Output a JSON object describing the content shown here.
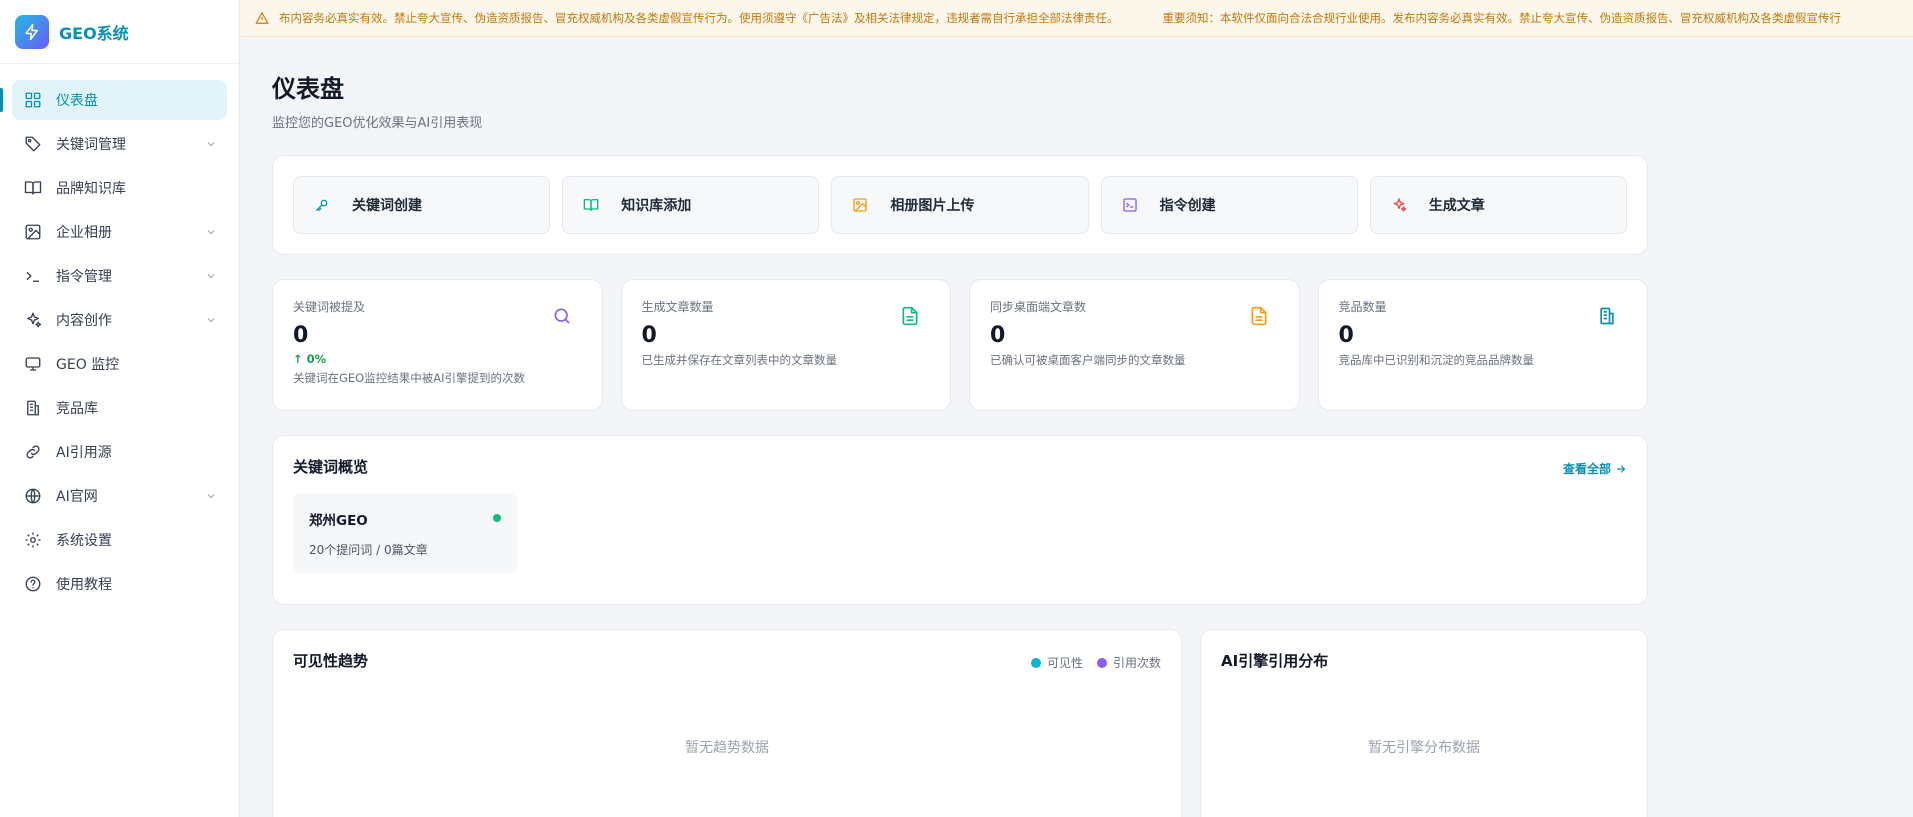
{
  "brand": {
    "name": "GEO系统",
    "logo_icon": "lightning-icon"
  },
  "sidebar": {
    "items": [
      {
        "label": "仪表盘",
        "icon": "dashboard-icon",
        "active": true,
        "expandable": false
      },
      {
        "label": "关键词管理",
        "icon": "tag-icon",
        "active": false,
        "expandable": true
      },
      {
        "label": "品牌知识库",
        "icon": "book-icon",
        "active": false,
        "expandable": false
      },
      {
        "label": "企业相册",
        "icon": "image-icon",
        "active": false,
        "expandable": true
      },
      {
        "label": "指令管理",
        "icon": "terminal-icon",
        "active": false,
        "expandable": true
      },
      {
        "label": "内容创作",
        "icon": "sparkles-icon",
        "active": false,
        "expandable": true
      },
      {
        "label": "GEO 监控",
        "icon": "monitor-icon",
        "active": false,
        "expandable": false
      },
      {
        "label": "竞品库",
        "icon": "building-icon",
        "active": false,
        "expandable": false
      },
      {
        "label": "AI引用源",
        "icon": "link-icon",
        "active": false,
        "expandable": false
      },
      {
        "label": "AI官网",
        "icon": "globe-icon",
        "active": false,
        "expandable": true
      },
      {
        "label": "系统设置",
        "icon": "gear-icon",
        "active": false,
        "expandable": false
      },
      {
        "label": "使用教程",
        "icon": "help-circle-icon",
        "active": false,
        "expandable": false
      }
    ]
  },
  "notice": {
    "icon": "warning-icon",
    "text1": "布内容务必真实有效。禁止夸大宣传、伪造资质报告、冒充权威机构及各类虚假宣传行为。使用须遵守《广告法》及相关法律规定，违规者需自行承担全部法律责任。",
    "text2": "重要须知：本软件仅面向合法合规行业使用。发布内容务必真实有效。禁止夸大宣传、伪造资质报告、冒充权威机构及各类虚假宣传行"
  },
  "header": {
    "title": "仪表盘",
    "subtitle": "监控您的GEO优化效果与AI引用表现"
  },
  "quick_actions": [
    {
      "label": "关键词创建",
      "icon": "key-icon",
      "color": "#0891b2"
    },
    {
      "label": "知识库添加",
      "icon": "book-open-icon",
      "color": "#10b981"
    },
    {
      "label": "相册图片上传",
      "icon": "image-icon",
      "color": "#f59e0b"
    },
    {
      "label": "指令创建",
      "icon": "terminal-icon",
      "color": "#8b5cf6"
    },
    {
      "label": "生成文章",
      "icon": "sparkles-icon",
      "color": "#ef4444"
    }
  ],
  "stats": [
    {
      "label": "关键词被提及",
      "value": "0",
      "trend": "↑ 0%",
      "desc": "关键词在GEO监控结果中被AI引擎提到的次数",
      "icon": "search-icon",
      "color": "#8b5cf6"
    },
    {
      "label": "生成文章数量",
      "value": "0",
      "trend": "",
      "desc": "已生成并保存在文章列表中的文章数量",
      "icon": "file-text-icon",
      "color": "#10b981"
    },
    {
      "label": "同步桌面端文章数",
      "value": "0",
      "trend": "",
      "desc": "已确认可被桌面客户端同步的文章数量",
      "icon": "file-text-icon",
      "color": "#f59e0b"
    },
    {
      "label": "竞品数量",
      "value": "0",
      "trend": "",
      "desc": "竞品库中已识别和沉淀的竞品品牌数量",
      "icon": "building-icon",
      "color": "#0891b2"
    }
  ],
  "keywords": {
    "title": "关键词概览",
    "view_all": "查看全部",
    "items": [
      {
        "name": "郑州GEO",
        "meta": "20个提问词 / 0篇文章",
        "status_color": "#10b981"
      }
    ]
  },
  "trend": {
    "title": "可见性趋势",
    "legend": [
      {
        "label": "可见性",
        "color": "#06b6d4"
      },
      {
        "label": "引用次数",
        "color": "#8b5cf6"
      }
    ],
    "empty": "暂无趋势数据"
  },
  "distribution": {
    "title": "AI引擎引用分布",
    "empty": "暂无引擎分布数据"
  },
  "colors": {
    "accent": "#0891b2",
    "success": "#10b981",
    "warning": "#c2780c"
  }
}
